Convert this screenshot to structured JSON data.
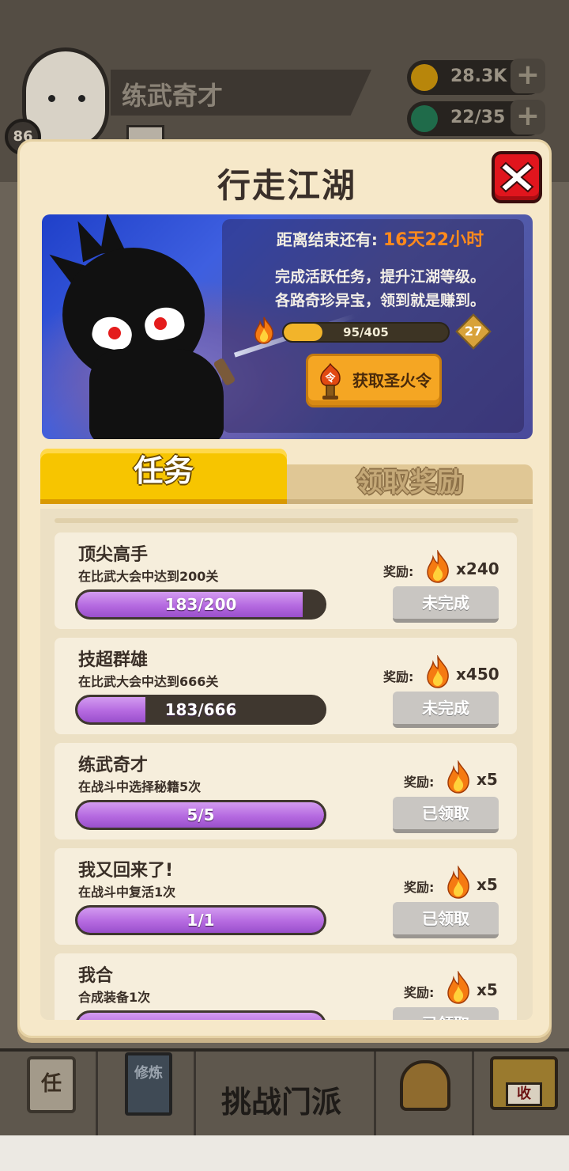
{
  "background": {
    "player_level": "86",
    "player_name": "练武奇才",
    "coins": "28.3K",
    "gems": "22/35",
    "nav_quest_glyph": "任",
    "nav_book_label": "修炼",
    "nav_challenge_label": "挑战门派",
    "nav_shop_glyph": "收"
  },
  "modal": {
    "title": "行走江湖",
    "close_icon": "close-x-icon",
    "banner": {
      "countdown_label": "距离结束还有:",
      "countdown_value": "16天22小时",
      "description_line1": "完成活跃任务，提升江湖等级。",
      "description_line2": "各路奇珍异宝，领到就是赚到。",
      "progress_text": "95/405",
      "progress_fraction": 0.235,
      "level": "27",
      "torch_button_label": "获取圣火令",
      "torch_icon_glyph": "令"
    },
    "tabs": [
      {
        "label": "任务",
        "active": true
      },
      {
        "label": "领取奖励",
        "active": false
      }
    ],
    "reward_label": "奖励:",
    "tasks": [
      {
        "title": "顶尖高手",
        "desc": "在比武大会中达到200关",
        "progress_text": "183/200",
        "progress_fraction": 0.915,
        "reward_count": "x240",
        "status": "未完成"
      },
      {
        "title": "技超群雄",
        "desc": "在比武大会中达到666关",
        "progress_text": "183/666",
        "progress_fraction": 0.275,
        "reward_count": "x450",
        "status": "未完成"
      },
      {
        "title": "练武奇才",
        "desc": "在战斗中选择秘籍5次",
        "progress_text": "5/5",
        "progress_fraction": 1.0,
        "reward_count": "x5",
        "status": "已领取"
      },
      {
        "title": "我又回来了!",
        "desc": "在战斗中复活1次",
        "progress_text": "1/1",
        "progress_fraction": 1.0,
        "reward_count": "x5",
        "status": "已领取"
      },
      {
        "title": "我合",
        "desc": "合成装备1次",
        "progress_text": "",
        "progress_fraction": 1.0,
        "reward_count": "x5",
        "status": "已领取"
      }
    ]
  },
  "colors": {
    "modal_bg": "#f6e8c9",
    "close_red": "#e0151d",
    "tab_active": "#f7c500",
    "progress_purple": "#b56ae0",
    "accent_orange": "#ff8a1c",
    "button_gray": "#c9c6c2"
  }
}
